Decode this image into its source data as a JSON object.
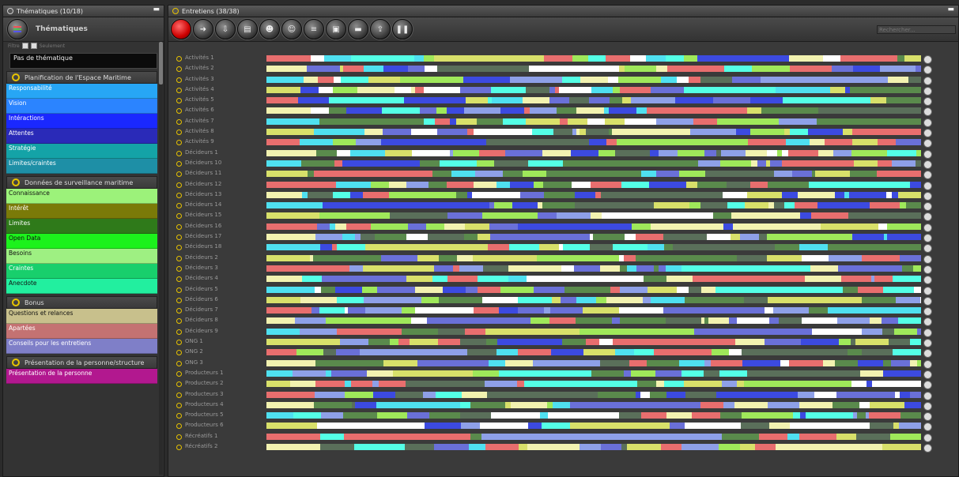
{
  "left": {
    "title": "Thématiques (10/18)",
    "header_title": "Thématiques",
    "filter_label": "Filtre",
    "filter_label2": "Seulement",
    "no_theme": "Pas de thématique",
    "groups": [
      {
        "title": "Planification de l'Espace Maritime",
        "items": [
          {
            "label": "Responsabilité",
            "color": "#27a6f5"
          },
          {
            "label": "Vision",
            "color": "#2b84ff"
          },
          {
            "label": "Intéractions",
            "color": "#1a28ff"
          },
          {
            "label": "Attentes",
            "color": "#2a2ab8"
          },
          {
            "label": "Stratégie",
            "color": "#14a3a7"
          },
          {
            "label": "Limites/craintes",
            "color": "#1e8fa6"
          }
        ]
      },
      {
        "title": "Données de surveillance maritime",
        "items": [
          {
            "label": "Connaissance",
            "color": "#9cf27a"
          },
          {
            "label": "Intérêt",
            "color": "#7a7a08"
          },
          {
            "label": "Limites",
            "color": "#2f7a1a"
          },
          {
            "label": "Open Data",
            "color": "#1cf21c"
          },
          {
            "label": "Besoins",
            "color": "#9ef082"
          },
          {
            "label": "Craintes",
            "color": "#18cf6c"
          },
          {
            "label": "Anecdote",
            "color": "#22ef9f"
          }
        ]
      },
      {
        "title": "Bonus",
        "items": [
          {
            "label": "Questions et relances",
            "color": "#c8c08c"
          },
          {
            "label": "Apartées",
            "color": "#c47272"
          },
          {
            "label": "Conseils pour les entretiens",
            "color": "#7f7fc8"
          }
        ]
      },
      {
        "title": "Présentation de la personne/structure",
        "items": [
          {
            "label": "Présentation de la personne",
            "color": "#b2188f"
          }
        ]
      }
    ]
  },
  "right": {
    "title": "Entretiens (38/38)",
    "search_placeholder": "Rechercher...",
    "toolbar_icons": [
      "record-icon",
      "forward-icon",
      "import-icon",
      "document-icon",
      "person-add-icon",
      "person-remove-icon",
      "list-icon",
      "image-icon",
      "remove-icon",
      "export-icon",
      "pause-icon"
    ],
    "palette": [
      "#5a8a4c",
      "#8ea0e8",
      "#4fe0f0",
      "#e86e6e",
      "#f2f2b0",
      "#d8e06a",
      "#5a6f5a",
      "#3c4ae0",
      "#6a70d8",
      "#54ffe6",
      "#9fe85a",
      "#ffffff"
    ],
    "interviews": [
      "Activités 1",
      "Activités 2",
      "Activités 3",
      "Activités 4",
      "Activités 5",
      "Activités 6",
      "Activités 7",
      "Activités 8",
      "Activités 9",
      "Décideurs 1",
      "Décideurs 10",
      "Décideurs 11",
      "Décideurs 12",
      "Décideurs 13",
      "Décideurs 14",
      "Décideurs 15",
      "Décideurs 16",
      "Décideurs 17",
      "Décideurs 18",
      "Décideurs 2",
      "Décideurs 3",
      "Décideurs 4",
      "Décideurs 5",
      "Décideurs 6",
      "Décideurs 7",
      "Décideurs 8",
      "Décideurs 9",
      "ONG 1",
      "ONG 2",
      "ONG 3",
      "Producteurs 1",
      "Producteurs 2",
      "Producteurs 3",
      "Producteurs 4",
      "Producteurs 5",
      "Producteurs 6",
      "Récréatifs 1",
      "Récréatifs 2"
    ]
  }
}
